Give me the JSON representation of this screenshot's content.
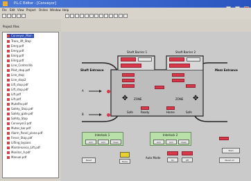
{
  "window": {
    "title": "P.L.C Editor - [Conveyor]"
  },
  "menu": [
    "File",
    "Edit",
    "View",
    "Project",
    "Online",
    "Window",
    "Help"
  ],
  "tree": {
    "header": "Project Files",
    "items": [
      "Conveyor_Main",
      "Trans_lift_Stop",
      "Emrg.pdf",
      "Emrg.pdf",
      "Emrg.pdf",
      "Emrg.pdf",
      "Line_Control.lib",
      "Pilot_stop.pdf",
      "Line_stop",
      "Line_stop2",
      "Lift_stop.pdf",
      "Lift_stop.pdf",
      "Lift.pdf",
      "Lift.pdf",
      "MutePar.pdf",
      "Safety_Stop.pdf",
      "Safety_gate.pdf",
      "Safety_Stop",
      "Conveyor2.pdf",
      "Mutes_bar.pdf",
      "Alarm_Panel_plane.pdf",
      "Fence_Stop.pdf",
      "Lifting_bypass",
      "Maintenance_Lift.pdf",
      "Monitor_A.pdf",
      "Manual.pdf"
    ]
  },
  "diagram": {
    "left_label": "Shaft Entrance",
    "right_label": "Mezz Entrance",
    "gate_a": "A",
    "gate_b": "B",
    "status_left": "Safe",
    "status_mid1": "Ready",
    "status_mid2": "Home",
    "status_right": "Safe",
    "door1_title": "Shaft Barrier 1",
    "door2_title": "Shaft Barrier 2",
    "group1_title": "Interlock 1",
    "group2_title": "Interlock 2",
    "reset_btn": "Reset",
    "auto_label": "Auto Mode",
    "btn_start": "Start",
    "btn_stop": "Stop",
    "btn_reset_all": "Reset All",
    "btn_mode": "Mode",
    "mode_label": "Mode",
    "ok_label": "OK",
    "sm1": "Arm",
    "sm2": "Arm",
    "sm3": "Arm",
    "sm4": "Arm",
    "clear_label": "Clear",
    "on_label": "On",
    "off_label": "Off",
    "gear_note": "ZONE",
    "gear_note2": "ZONE"
  }
}
